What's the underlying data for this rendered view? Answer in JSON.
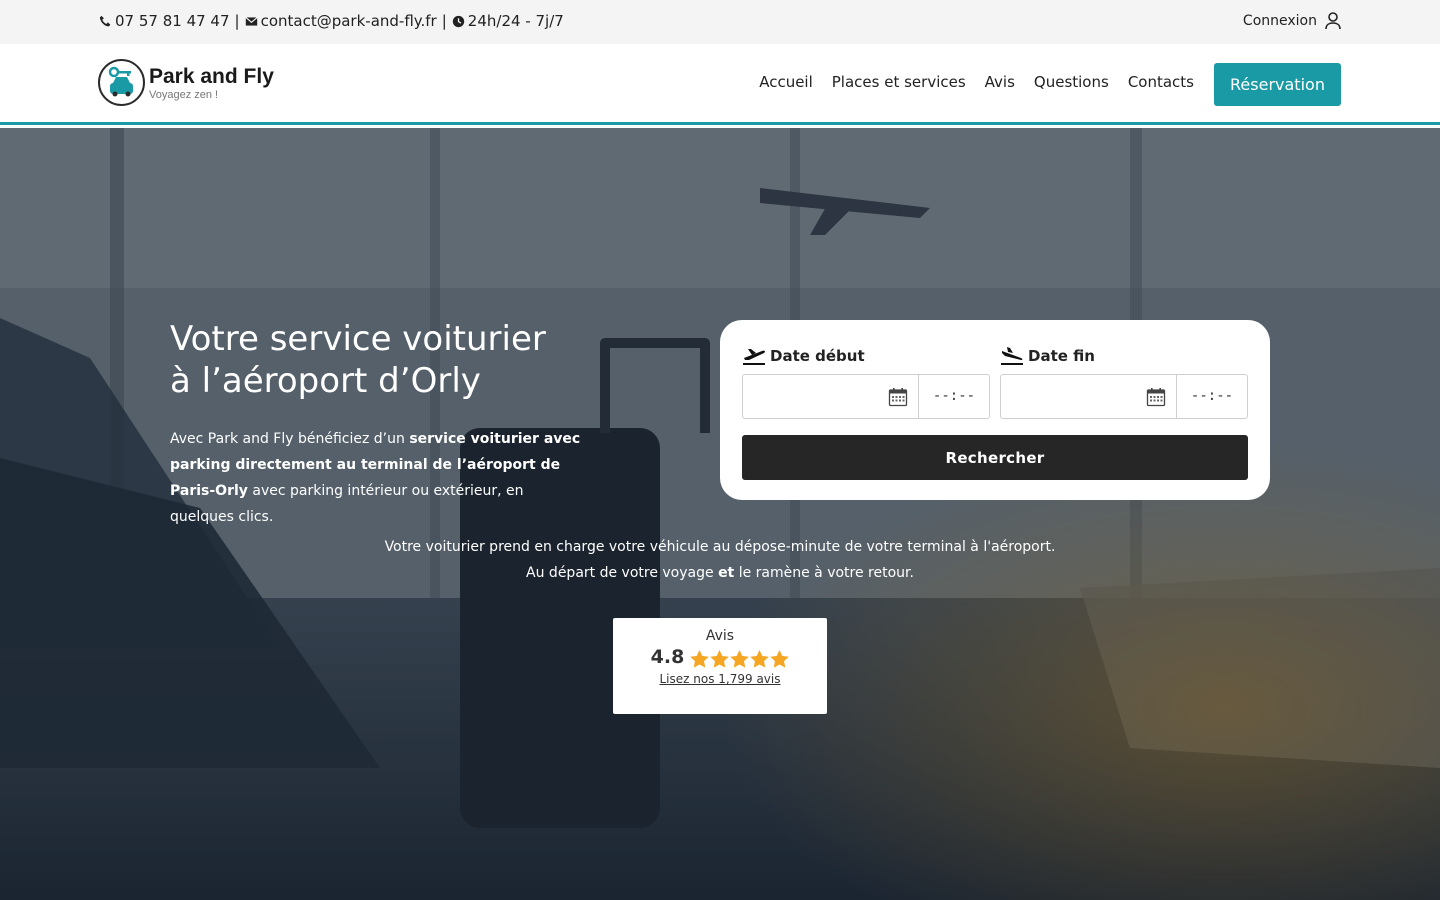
{
  "topbar": {
    "phone": "07 57 81 47 47",
    "email": "contact@park-and-fly.fr",
    "hours": "24h/24 - 7j/7",
    "separator": "|",
    "login_label": "Connexion"
  },
  "header": {
    "logo_title": "Park and Fly",
    "logo_subtitle": "Voyagez zen !",
    "nav": [
      "Accueil",
      "Places et services",
      "Avis",
      "Questions",
      "Contacts"
    ],
    "cta_label": "Réservation"
  },
  "hero": {
    "title_line1": "Votre service voiturier",
    "title_line2": "à l’aéroport d’Orly",
    "desc_part1": "Avec Park and Fly bénéficiez d’un ",
    "desc_bold1": "service voiturier avec parking directement au terminal de l’aéroport de Paris-Orly",
    "desc_part2": " avec parking intérieur ou extérieur, en quelques clics.",
    "center_line1": "Votre voiturier prend en charge votre véhicule au dépose-minute de votre terminal à l'aéroport.",
    "center_line2_part1": "Au départ de votre voyage ",
    "center_line2_bold": "et",
    "center_line2_part2": " le ramène à votre retour."
  },
  "booking": {
    "start_label": "Date début",
    "end_label": "Date fin",
    "start_date_value": "",
    "end_date_value": "",
    "start_time_value": "--:--",
    "end_time_value": "--:--",
    "search_label": "Rechercher",
    "start_icon": "plane-takeoff-icon",
    "end_icon": "plane-landing-icon"
  },
  "reviews": {
    "title": "Avis",
    "score": "4.8",
    "stars": 5,
    "link_label": "Lisez nos 1,799 avis"
  },
  "colors": {
    "accent": "#1a9aa5",
    "button_dark": "#262626",
    "star": "#f5a623",
    "topbar_bg": "#f4f4f4"
  }
}
